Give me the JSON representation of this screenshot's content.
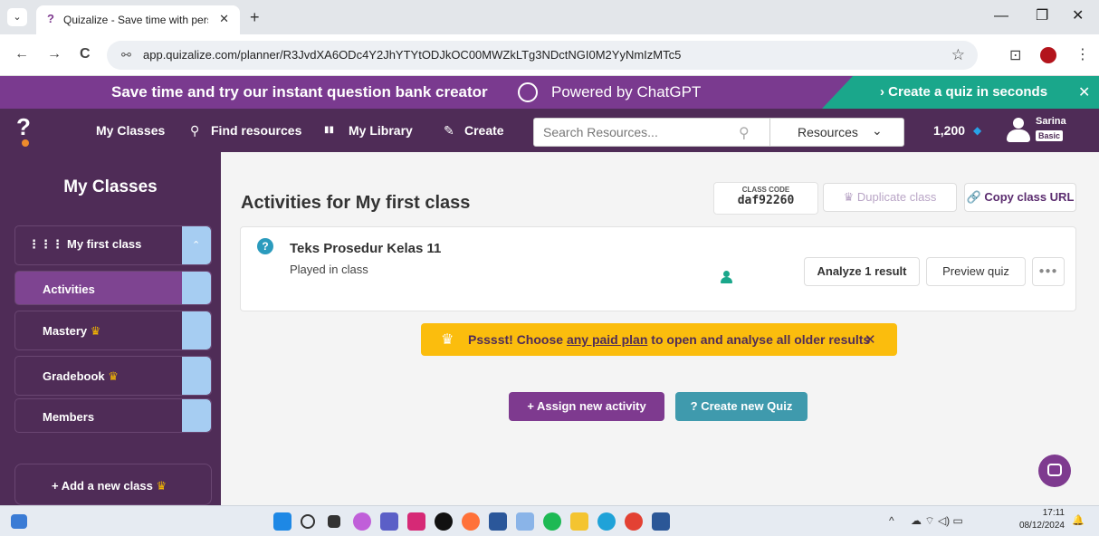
{
  "browser": {
    "tab_title": "Quizalize - Save time with perso",
    "tab_close": "✕",
    "new_tab": "+",
    "menu_chevron": "⌄",
    "win_minimize": "—",
    "win_restore": "❐",
    "win_close": "✕",
    "back": "←",
    "forward": "→",
    "reload": "C",
    "site_info": "⚯",
    "url": "app.quizalize.com/planner/R3JvdXA6ODc4Y2JhYTYtODJkOC00MWZkLTg3NDctNGI0M2YyNmIzMTc5",
    "bookmark": "☆",
    "extensions": "⊡",
    "more": "⋮"
  },
  "promo": {
    "text": "Save time and try our instant question bank creator",
    "powered": "Powered by ChatGPT",
    "cta": "›  Create a quiz in seconds",
    "close": "✕"
  },
  "nav": {
    "my_classes": "My Classes",
    "find_resources": "Find resources",
    "find_icon": "⚲",
    "my_library": "My Library",
    "library_icon": "▮▮",
    "create": "Create",
    "create_icon": "✎",
    "search_placeholder": "Search Resources...",
    "search_icon": "⚲",
    "resources": "Resources",
    "resources_chevron": "⌄",
    "coins": "1,200",
    "coin_icon": "◆",
    "user_name": "Sarina",
    "user_plan": "Basic"
  },
  "sidebar": {
    "title": "My Classes",
    "class_name": "My first class",
    "class_icon": "⋮⋮⋮",
    "collapse": "⌃",
    "items": [
      {
        "label": "Activities"
      },
      {
        "label": "Mastery"
      },
      {
        "label": "Gradebook"
      },
      {
        "label": "Members"
      }
    ],
    "crown": "♛",
    "add_class": "+ Add a new class"
  },
  "main": {
    "title": "Activities for My first class",
    "class_code_label": "CLASS CODE",
    "class_code": "daf92260",
    "duplicate": "♛ Duplicate class",
    "copy_url": "🔗 Copy class URL",
    "activity": {
      "icon": "?",
      "title": "Teks Prosedur Kelas 11",
      "subtitle": "Played in class",
      "analyze": "Analyze 1 result",
      "preview": "Preview quiz",
      "more": "●●●"
    },
    "notice": {
      "crown": "♛",
      "before": "Psssst! Choose ",
      "link": "any paid plan",
      "after": " to open and analyse all older results",
      "close": "✕"
    },
    "assign": "+  Assign new activity",
    "create_quiz": "? Create new Quiz"
  },
  "taskbar": {
    "time": "17:11",
    "date": "08/12/2024",
    "tray_up": "^",
    "tray_icons": "☁  ⌔ ◁) ▭",
    "bell": "🔔"
  },
  "colors": {
    "brand_purple": "#4f2c57",
    "promo_purple": "#7a3a8f",
    "promo_green": "#1aa78b",
    "accent_blue": "#a6cdf2",
    "notice_yellow": "#fbbd0d",
    "assign_purple": "#7e3a8f",
    "create_teal": "#3f9aad"
  }
}
